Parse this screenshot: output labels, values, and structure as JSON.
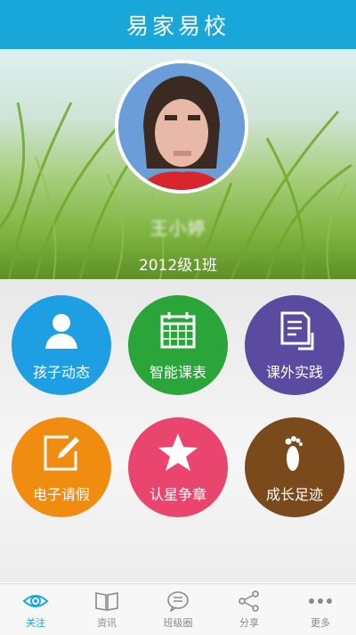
{
  "app": {
    "title": "易家易校"
  },
  "student": {
    "name": "王小婷",
    "class": "2012级1班"
  },
  "tiles": [
    {
      "label": "孩子动态",
      "color": "#1e9fe3",
      "icon": "person-icon"
    },
    {
      "label": "智能课表",
      "color": "#2aa53a",
      "icon": "calendar-icon"
    },
    {
      "label": "课外实践",
      "color": "#5a4aa0",
      "icon": "document-icon"
    },
    {
      "label": "电子请假",
      "color": "#f08c10",
      "icon": "edit-note-icon"
    },
    {
      "label": "认星争章",
      "color": "#e9456e",
      "icon": "star-icon"
    },
    {
      "label": "成长足迹",
      "color": "#7a4a1c",
      "icon": "footprint-icon"
    }
  ],
  "bottom_tabs": [
    {
      "label": "关注",
      "icon": "eye-icon",
      "active": true
    },
    {
      "label": "资讯",
      "icon": "book-icon",
      "active": false
    },
    {
      "label": "班级圈",
      "icon": "chat-bubble-icon",
      "active": false
    },
    {
      "label": "分享",
      "icon": "share-icon",
      "active": false
    },
    {
      "label": "更多",
      "icon": "more-dots-icon",
      "active": false
    }
  ],
  "colors": {
    "accent": "#18a7d8",
    "inactive": "#8a8a8a"
  }
}
